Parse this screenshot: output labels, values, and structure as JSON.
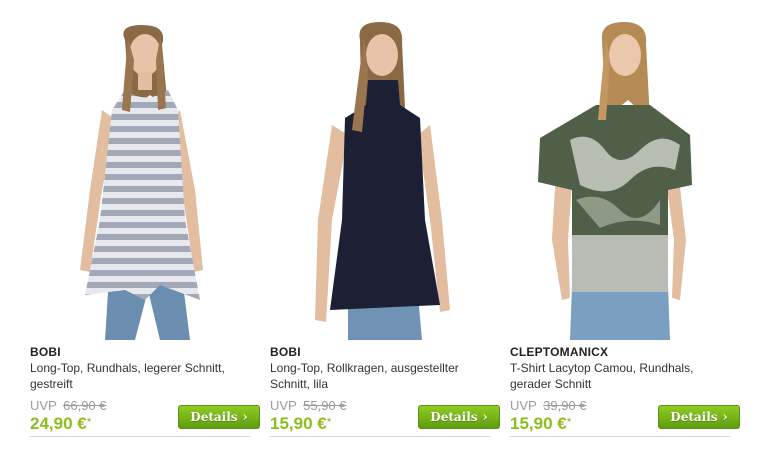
{
  "products": [
    {
      "brand": "BOBI",
      "line1": "Long-Top, Rundhals, legerer Schnitt,",
      "line2": "gestreift",
      "uvp_label": "UVP",
      "old_price": "66,90 €",
      "price": "24,90 €",
      "price_marker": "*",
      "button_label": "Details",
      "button_icon": "chevron-right-icon",
      "colors": {
        "top": "#c9ccd6",
        "stripe": "#a3a8b6",
        "jeans": "#6a8db0"
      }
    },
    {
      "brand": "BOBI",
      "line1": "Long-Top, Rollkragen, ausgestellter",
      "line2": "Schnitt, lila",
      "uvp_label": "UVP",
      "old_price": "55,90 €",
      "price": "15,90 €",
      "price_marker": "*",
      "button_label": "Details",
      "button_icon": "chevron-right-icon",
      "colors": {
        "top": "#1d1f35",
        "jeans": "#6f92b5"
      }
    },
    {
      "brand": "CLEPTOMANICX",
      "line1": "T-Shirt Lacytop Camou, Rundhals,",
      "line2": "gerader Schnitt",
      "uvp_label": "UVP",
      "old_price": "39,90 €",
      "price": "15,90 €",
      "price_marker": "*",
      "button_label": "Details",
      "button_icon": "chevron-right-icon",
      "colors": {
        "top": "#4f5f48",
        "camo": "#c9cfc2",
        "hem": "#b9bcb4",
        "jeans": "#7a9fc0"
      }
    }
  ],
  "theme": {
    "accent_green": "#8bbd1e",
    "muted": "#999999"
  }
}
